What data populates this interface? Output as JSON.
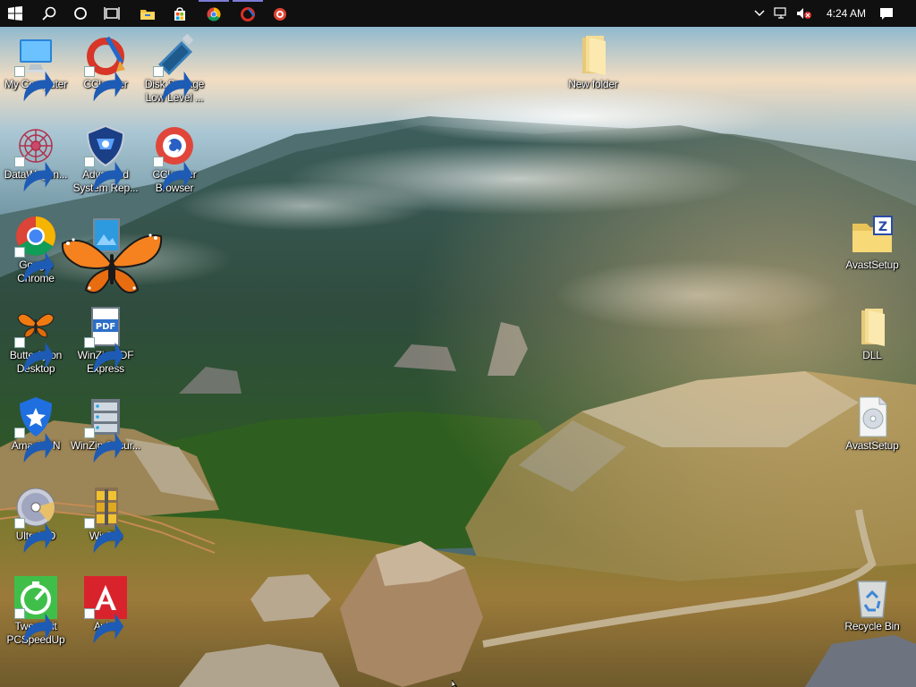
{
  "taskbar": {
    "start_icon": "windows-logo-icon",
    "search_icon": "search-icon",
    "cortana_icon": "cortana-circle-icon",
    "task_view_icon": "task-view-icon",
    "pinned": [
      {
        "name": "file-explorer-icon"
      },
      {
        "name": "store-icon"
      },
      {
        "name": "chrome-icon"
      },
      {
        "name": "ccleaner-icon"
      },
      {
        "name": "ccleaner-browser-icon"
      }
    ],
    "tray": {
      "chevron_icon": "chevron-up-icon",
      "network_icon": "network-icon",
      "volume_icon": "volume-muted-icon",
      "clock": "4:24 AM",
      "notifications_icon": "action-center-icon"
    },
    "accent_color": "#7b7bd6"
  },
  "desktop": {
    "icons": [
      {
        "label": "My Computer"
      },
      {
        "label": "CCleaner"
      },
      {
        "label": "Disk Storage Low Level ..."
      },
      {
        "label": "DataWagon..."
      },
      {
        "label": "Advanced System Rep..."
      },
      {
        "label": "CCleaner Browser"
      },
      {
        "label": "Google Chrome"
      },
      {
        "label": "Butterfly on Desktop"
      },
      {
        "label": "WinZip PDF Express"
      },
      {
        "label": "AmanVPN"
      },
      {
        "label": "WinZip Secur..."
      },
      {
        "label": "UltraISO"
      },
      {
        "label": "WinZip"
      },
      {
        "label": "TweakBit PCSpeedUp"
      },
      {
        "label": "Avira"
      },
      {
        "label": "New folder"
      },
      {
        "label": "AvastSetup"
      },
      {
        "label": "DLL"
      },
      {
        "label": "AvastSetup"
      },
      {
        "label": "Recycle Bin"
      }
    ]
  }
}
